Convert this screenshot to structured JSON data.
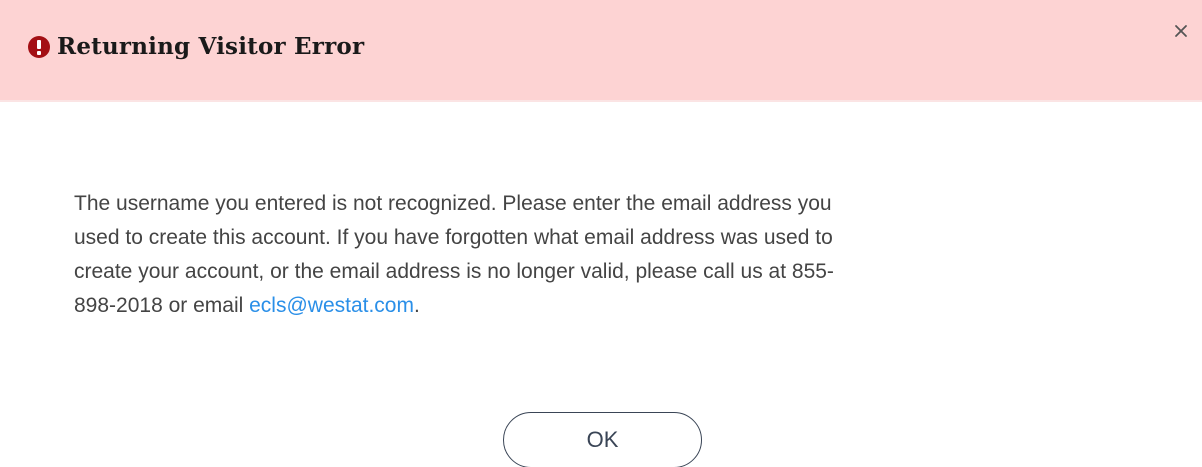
{
  "dialog": {
    "title": "Returning Visitor Error",
    "close_label": "×",
    "message": {
      "line_1": "The username you entered is not recognized. Please enter the email address you",
      "line_2": "used to create this account. If you have forgotten what email address was used to",
      "line_3": "create your account, or the email address is no longer valid, please call us at 855-",
      "line_4_prefix": "898-2018 or email ",
      "email": "ecls@westat.com",
      "line_4_suffix": "."
    },
    "ok_label": "OK"
  },
  "icons": {
    "alert": "exclamation-circle-icon",
    "close": "close-icon"
  },
  "colors": {
    "header_background": "#fdd3d3",
    "alert_icon": "#a30f14",
    "link": "#2a8fe8",
    "body_text": "#444444",
    "button_border": "#3a4556"
  }
}
